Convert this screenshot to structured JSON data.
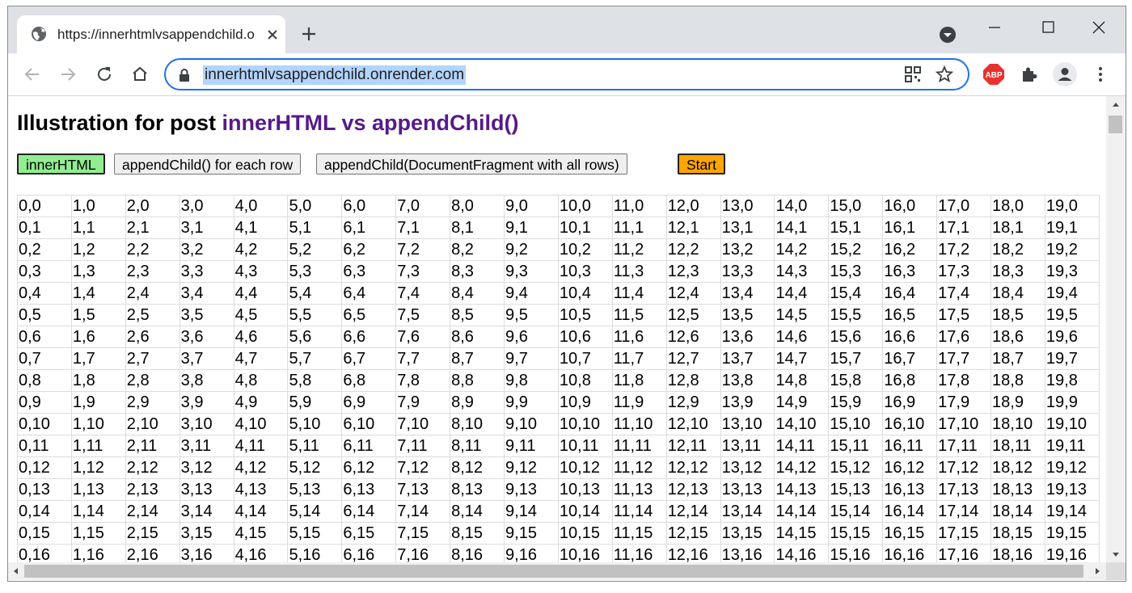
{
  "browser": {
    "tab_title": "https://innerhtmlvsappendchild.o",
    "url": "innerhtmlvsappendchild.onrender.com",
    "abp_label": "ABP",
    "accent_color": "#1a73e8"
  },
  "page": {
    "heading_prefix": "Illustration for post ",
    "heading_link": "innerHTML vs appendChild()",
    "heading_link_color": "#551a8b",
    "buttons": {
      "innerhtml": "innerHTML",
      "appendchild_each": "appendChild() for each row",
      "appendchild_fragment": "appendChild(DocumentFragment with all rows)",
      "start": "Start"
    },
    "active_button_color": "#90ee90",
    "start_button_color": "#ffa500"
  },
  "table": {
    "columns": 20,
    "rows": 17,
    "cell_format": "{col},{row}"
  }
}
